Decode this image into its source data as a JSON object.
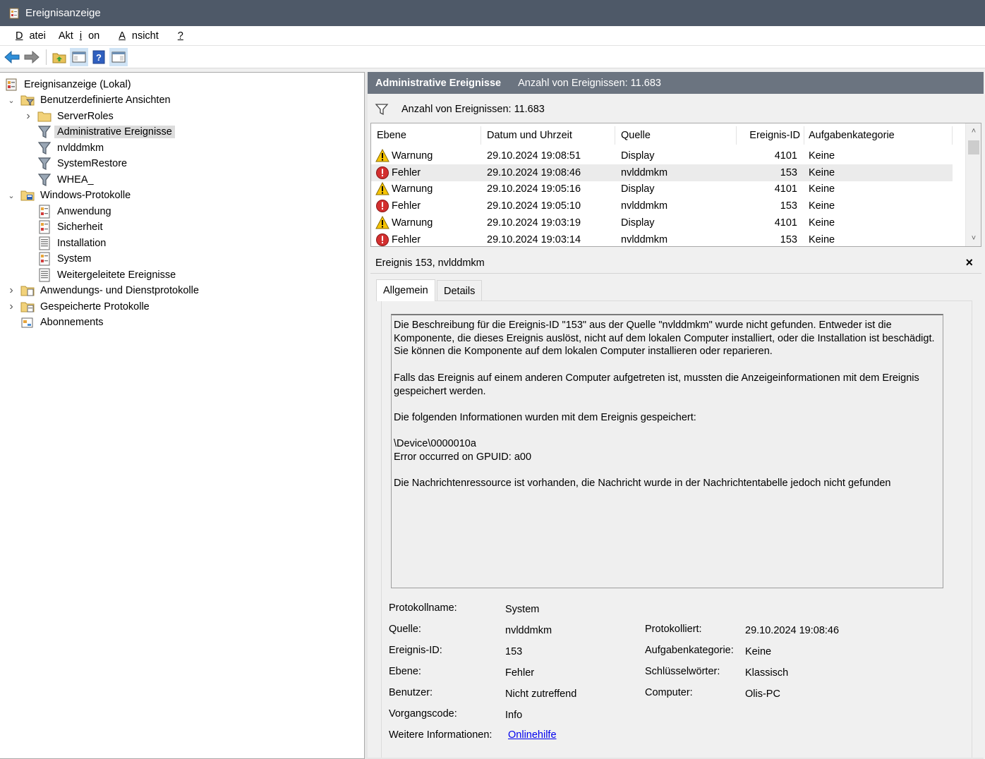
{
  "window": {
    "title": "Ereignisanzeige"
  },
  "menu": [
    "Datei",
    "Aktion",
    "Ansicht",
    "?"
  ],
  "toolbar": {
    "buttons": [
      "back-icon",
      "forward-icon",
      "folder-up-icon",
      "show-hide-tree-icon",
      "help-icon",
      "show-hide-action-pane-icon"
    ]
  },
  "tree": [
    {
      "label": "Ereignisanzeige (Lokal)",
      "icon": "event-viewer-icon",
      "level": 0,
      "expander": ""
    },
    {
      "label": "Benutzerdefinierte Ansichten",
      "icon": "custom-views-folder-icon",
      "level": 0,
      "expander": "expanded"
    },
    {
      "label": "ServerRoles",
      "icon": "folder-icon",
      "level": 1,
      "expander": "collapsed"
    },
    {
      "label": "Administrative Ereignisse",
      "icon": "filter-icon",
      "level": 1,
      "expander": "",
      "selected": true
    },
    {
      "label": "nvlddmkm",
      "icon": "filter-icon",
      "level": 1,
      "expander": ""
    },
    {
      "label": "SystemRestore",
      "icon": "filter-icon",
      "level": 1,
      "expander": ""
    },
    {
      "label": "WHEA_",
      "icon": "filter-icon",
      "level": 1,
      "expander": ""
    },
    {
      "label": "Windows-Protokolle",
      "icon": "windows-logs-folder-icon",
      "level": 0,
      "expander": "expanded"
    },
    {
      "label": "Anwendung",
      "icon": "log-icon",
      "level": 1,
      "expander": ""
    },
    {
      "label": "Sicherheit",
      "icon": "log-icon",
      "level": 1,
      "expander": ""
    },
    {
      "label": "Installation",
      "icon": "log-plain-icon",
      "level": 1,
      "expander": ""
    },
    {
      "label": "System",
      "icon": "log-icon",
      "level": 1,
      "expander": ""
    },
    {
      "label": "Weitergeleitete Ereignisse",
      "icon": "log-plain-icon",
      "level": 1,
      "expander": ""
    },
    {
      "label": "Anwendungs- und Dienstprotokolle",
      "icon": "app-logs-folder-icon",
      "level": 0,
      "expander": "collapsed"
    },
    {
      "label": "Gespeicherte Protokolle",
      "icon": "saved-logs-folder-icon",
      "level": 0,
      "expander": "collapsed"
    },
    {
      "label": "Abonnements",
      "icon": "subscriptions-icon",
      "level": 0,
      "expander": ""
    }
  ],
  "view": {
    "title": "Administrative Ereignisse",
    "count_label": "Anzahl von Ereignissen: 11.683",
    "filter_label": "Anzahl von Ereignissen: 11.683"
  },
  "grid": {
    "columns": [
      "Ebene",
      "Datum und Uhrzeit",
      "Quelle",
      "Ereignis-ID",
      "Aufgabenkategorie"
    ],
    "rows": [
      {
        "level": "Warnung",
        "icon": "warning-icon",
        "date": "29.10.2024 19:08:51",
        "source": "Display",
        "id": "4101",
        "category": "Keine"
      },
      {
        "level": "Fehler",
        "icon": "error-icon",
        "date": "29.10.2024 19:08:46",
        "source": "nvlddmkm",
        "id": "153",
        "category": "Keine",
        "selected": true
      },
      {
        "level": "Warnung",
        "icon": "warning-icon",
        "date": "29.10.2024 19:05:16",
        "source": "Display",
        "id": "4101",
        "category": "Keine"
      },
      {
        "level": "Fehler",
        "icon": "error-icon",
        "date": "29.10.2024 19:05:10",
        "source": "nvlddmkm",
        "id": "153",
        "category": "Keine"
      },
      {
        "level": "Warnung",
        "icon": "warning-icon",
        "date": "29.10.2024 19:03:19",
        "source": "Display",
        "id": "4101",
        "category": "Keine"
      },
      {
        "level": "Fehler",
        "icon": "error-icon",
        "date": "29.10.2024 19:03:14",
        "source": "nvlddmkm",
        "id": "153",
        "category": "Keine"
      }
    ]
  },
  "detail": {
    "title": "Ereignis 153, nvlddmkm",
    "close": "×",
    "tabs": [
      "Allgemein",
      "Details"
    ],
    "description": [
      "Die Beschreibung für die Ereignis-ID \"153\" aus der Quelle \"nvlddmkm\" wurde nicht gefunden. Entweder ist die Komponente, die dieses Ereignis auslöst, nicht auf dem lokalen Computer installiert, oder die Installation ist beschädigt. Sie können die Komponente auf dem lokalen Computer installieren oder reparieren.",
      "Falls das Ereignis auf einem anderen Computer aufgetreten ist, mussten die Anzeigeinformationen mit dem Ereignis gespeichert werden.",
      "Die folgenden Informationen wurden mit dem Ereignis gespeichert:",
      "\\Device\\0000010a\nError occurred on GPUID: a00",
      "Die Nachrichtenressource ist vorhanden, die Nachricht wurde in der Nachrichtentabelle jedoch nicht gefunden"
    ],
    "props": {
      "protokollname_label": "Protokollname:",
      "protokollname": "System",
      "quelle_label": "Quelle:",
      "quelle": "nvlddmkm",
      "protokolliert_label": "Protokolliert:",
      "protokolliert": "29.10.2024 19:08:46",
      "ereignis_id_label": "Ereignis-ID:",
      "ereignis_id": "153",
      "aufgabe_label": "Aufgabenkategorie:",
      "aufgabe": "Keine",
      "ebene_label": "Ebene:",
      "ebene": "Fehler",
      "schluessel_label": "Schlüsselwörter:",
      "schluessel": "Klassisch",
      "benutzer_label": "Benutzer:",
      "benutzer": "Nicht zutreffend",
      "computer_label": "Computer:",
      "computer": "Olis-PC",
      "vorgang_label": "Vorgangscode:",
      "vorgang": "Info",
      "weitere_label": "Weitere Informationen:",
      "weitere": "Onlinehilfe"
    }
  }
}
